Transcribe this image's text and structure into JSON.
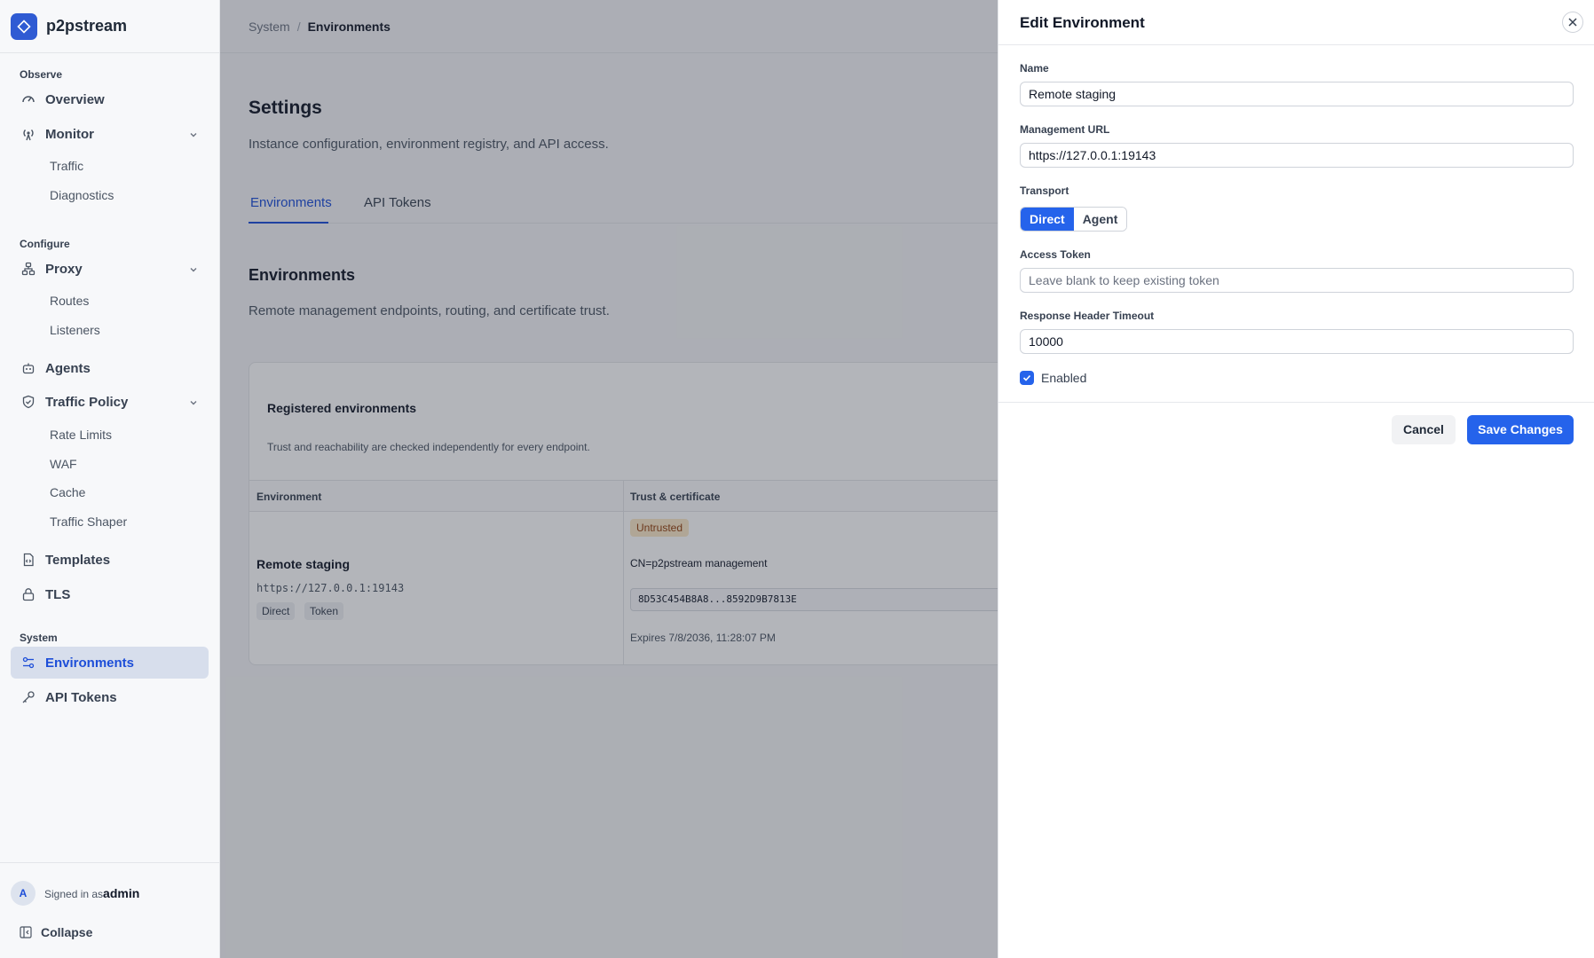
{
  "brand": {
    "name": "p2pstream"
  },
  "sidebar": {
    "sections": {
      "observe": "Observe",
      "configure": "Configure",
      "system": "System"
    },
    "items": {
      "overview": "Overview",
      "monitor": "Monitor",
      "traffic": "Traffic",
      "diagnostics": "Diagnostics",
      "proxy": "Proxy",
      "routes": "Routes",
      "listeners": "Listeners",
      "agents": "Agents",
      "traffic_policy": "Traffic Policy",
      "rate_limits": "Rate Limits",
      "waf": "WAF",
      "cache": "Cache",
      "traffic_shaper": "Traffic Shaper",
      "templates": "Templates",
      "tls": "TLS",
      "environments": "Environments",
      "api_tokens": "API Tokens"
    },
    "footer": {
      "avatar_initial": "A",
      "signed_in_prefix": "Signed in as",
      "username": "admin",
      "collapse": "Collapse"
    }
  },
  "breadcrumb": {
    "parent": "System",
    "separator": "/",
    "current": "Environments"
  },
  "page": {
    "title": "Settings",
    "subtitle": "Instance configuration, environment registry, and API access.",
    "tabs": [
      "Environments",
      "API Tokens"
    ],
    "section_title": "Environments",
    "section_subtitle": "Remote management endpoints, routing, and certificate trust."
  },
  "card": {
    "title": "Registered environments",
    "subtitle": "Trust and reachability are checked independently for every endpoint.",
    "columns": [
      "Environment",
      "Trust & certificate"
    ],
    "row": {
      "name": "Remote staging",
      "url": "https://127.0.0.1:19143",
      "chips": [
        "Direct",
        "Token"
      ],
      "trust_badge": "Untrusted",
      "cn": "CN=p2pstream management",
      "fingerprint": "8D53C454B8A8...8592D9B7813E",
      "expires": "Expires 7/8/2036, 11:28:07 PM"
    }
  },
  "drawer": {
    "title": "Edit Environment",
    "name_label": "Name",
    "name_value": "Remote staging",
    "url_label": "Management URL",
    "url_value": "https://127.0.0.1:19143",
    "transport_label": "Transport",
    "transport_options": [
      "Direct",
      "Agent"
    ],
    "transport_selected": "Direct",
    "token_label": "Access Token",
    "token_placeholder": "Leave blank to keep existing token",
    "timeout_label": "Response Header Timeout",
    "timeout_value": "10000",
    "enabled_label": "Enabled",
    "enabled": true,
    "cancel": "Cancel",
    "save": "Save Changes"
  },
  "colors": {
    "accent": "#2563eb",
    "brand": "#2f5bd3",
    "warning_bg": "#fbe9c8",
    "warning_fg": "#92400e"
  }
}
